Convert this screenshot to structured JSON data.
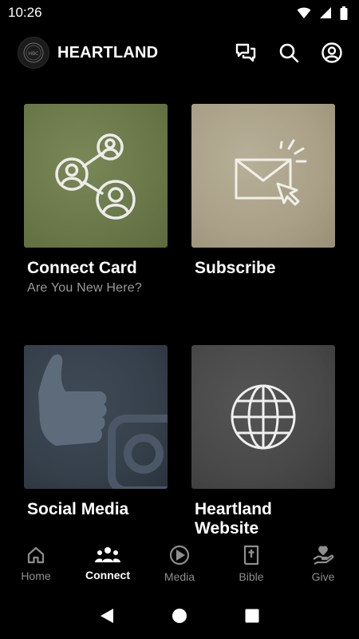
{
  "status_bar": {
    "time": "10:26"
  },
  "header": {
    "title": "HEARTLAND",
    "logo_letters": "HBC"
  },
  "cards": [
    {
      "title": "Connect Card",
      "subtitle": "Are You New Here?",
      "icon": "share-people-icon",
      "color": "#6f7c4c"
    },
    {
      "title": "Subscribe",
      "subtitle": "",
      "icon": "envelope-click-icon",
      "color": "#a9a087"
    },
    {
      "title": "Social Media",
      "subtitle": "",
      "icon": "thumbs-up-camera-icon",
      "color": "#35404b"
    },
    {
      "title": "Heartland Website",
      "subtitle": "",
      "icon": "globe-icon",
      "color": "#484848"
    }
  ],
  "bottom_nav": [
    {
      "label": "Home",
      "icon": "home-icon",
      "active": false
    },
    {
      "label": "Connect",
      "icon": "group-icon",
      "active": true
    },
    {
      "label": "Media",
      "icon": "play-circle-icon",
      "active": false
    },
    {
      "label": "Bible",
      "icon": "bible-icon",
      "active": false
    },
    {
      "label": "Give",
      "icon": "give-hand-heart-icon",
      "active": false
    }
  ]
}
